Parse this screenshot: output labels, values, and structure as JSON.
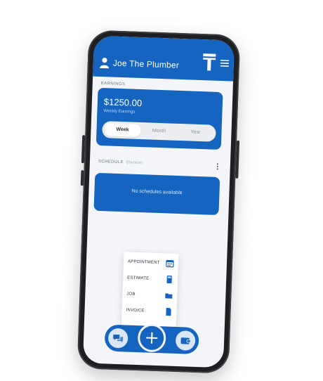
{
  "header": {
    "title": "Joe The Plumber",
    "avatar_icon": "person-icon",
    "logo_icon": "t-logo-icon",
    "menu_icon": "hamburger-menu-icon"
  },
  "earnings": {
    "section_label": "EARNINGS",
    "amount": "$1250.00",
    "subtitle": "Weekly Earnings",
    "periods": [
      {
        "label": "Week",
        "active": true
      },
      {
        "label": "Month",
        "active": false
      },
      {
        "label": "Year",
        "active": false
      }
    ]
  },
  "schedule": {
    "section_label": "SCHEDULE",
    "sub_label": "(Invoice)",
    "more_icon": "kebab-menu-icon",
    "empty_text": "No schedules available"
  },
  "quick_menu": {
    "items": [
      {
        "label": "APPOINTMENT",
        "icon": "calendar-icon"
      },
      {
        "label": "ESTIMATE",
        "icon": "calculator-icon"
      },
      {
        "label": "JOB",
        "icon": "folder-icon"
      },
      {
        "label": "INVOICE",
        "icon": "document-icon"
      }
    ]
  },
  "bottom_nav": {
    "left_icon": "chat-icon",
    "center_icon": "plus-icon",
    "right_icon": "wallet-icon"
  },
  "colors": {
    "primary": "#1565c0",
    "screen_bg": "#f3f5f8",
    "phone_frame": "#1e1f22"
  }
}
